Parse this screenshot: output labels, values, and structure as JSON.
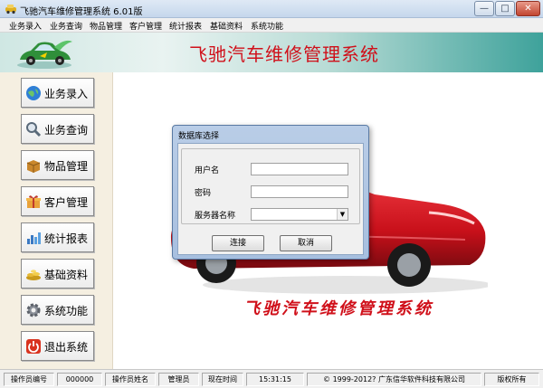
{
  "window": {
    "title": "飞驰汽车维修管理系统 6.01版",
    "min_glyph": "—",
    "max_glyph": "□",
    "close_glyph": "✕"
  },
  "menu": [
    "业务录入",
    "业务查询",
    "物品管理",
    "客户管理",
    "统计报表",
    "基础资料",
    "系统功能"
  ],
  "header": {
    "title": "飞驰汽车维修管理系统"
  },
  "sidebar": [
    {
      "label": "业务录入",
      "icon": "globe-icon"
    },
    {
      "label": "业务查询",
      "icon": "magnifier-icon"
    },
    {
      "label": "物品管理",
      "icon": "box-icon"
    },
    {
      "label": "客户管理",
      "icon": "gift-icon"
    },
    {
      "label": "统计报表",
      "icon": "bar-chart-icon"
    },
    {
      "label": "基础资料",
      "icon": "gold-pile-icon"
    },
    {
      "label": "系统功能",
      "icon": "gear-icon"
    },
    {
      "label": "退出系统",
      "icon": "power-icon"
    }
  ],
  "content": {
    "slogan": "飞驰汽车维修管理系统"
  },
  "dialog": {
    "title": "数据库选择",
    "username_label": "用户名",
    "username_value": "",
    "password_label": "密码",
    "password_value": "",
    "server_label": "服务器名称",
    "server_value": "",
    "connect_label": "连接",
    "cancel_label": "取消"
  },
  "status": {
    "operator_id_label": "操作员编号",
    "operator_id": "000000",
    "operator_name_label": "操作员姓名",
    "operator_name": "管理员",
    "time_label": "现在时间",
    "time": "15:31:15",
    "copyright": "1999-2012? 广东信华软件科技有限公司",
    "rights": "版权所有"
  },
  "colors": {
    "title_red": "#d0101a",
    "banner_teal": "#3ea29b",
    "sidebar_bg": "#f5efe1",
    "car_red": "#c8101a"
  }
}
